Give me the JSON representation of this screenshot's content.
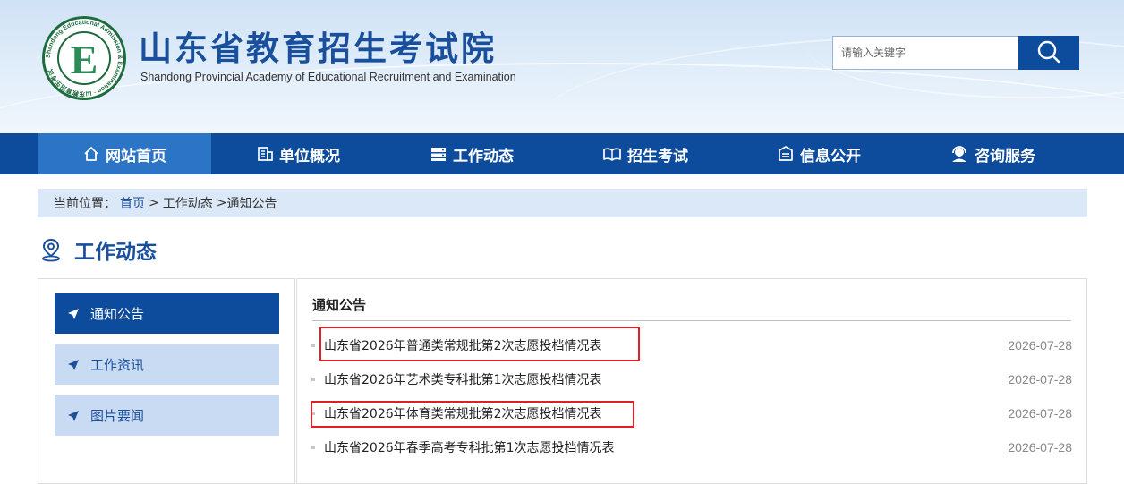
{
  "header": {
    "seal_text": "Shandong Educational Admission & Examination · 山东教育招生考试",
    "seal_letter": "E",
    "title": "山东省教育招生考试院",
    "subtitle": "Shandong Provincial Academy of Educational Recruitment and Examination",
    "search_placeholder": "请输入关键字",
    "search_icon": "search-icon"
  },
  "nav": {
    "items": [
      {
        "label": "网站首页",
        "icon": "home-icon",
        "active": true
      },
      {
        "label": "单位概况",
        "icon": "building-icon",
        "active": false
      },
      {
        "label": "工作动态",
        "icon": "server-icon",
        "active": false
      },
      {
        "label": "招生考试",
        "icon": "book-icon",
        "active": false
      },
      {
        "label": "信息公开",
        "icon": "inbox-icon",
        "active": false
      },
      {
        "label": "咨询服务",
        "icon": "support-icon",
        "active": false
      }
    ]
  },
  "breadcrumb": {
    "prefix": "当前位置：",
    "home": "首页",
    "sep1": ">",
    "level1": "工作动态",
    "sep2": ">",
    "level2": "通知公告"
  },
  "section": {
    "title": "工作动态",
    "icon": "location-pin-icon"
  },
  "sidebar": {
    "items": [
      {
        "label": "通知公告",
        "active": true
      },
      {
        "label": "工作资讯",
        "active": false
      },
      {
        "label": "图片要闻",
        "active": false
      }
    ]
  },
  "main": {
    "heading": "通知公告",
    "rows": [
      {
        "title": "山东省2026年普通类常规批第2次志愿投档情况表",
        "date": "2026-07-28",
        "highlighted": true
      },
      {
        "title": "山东省2026年艺术类专科批第1次志愿投档情况表",
        "date": "2026-07-28",
        "highlighted": false
      },
      {
        "title": "山东省2026年体育类常规批第2次志愿投档情况表",
        "date": "2026-07-28",
        "highlighted": true
      },
      {
        "title": "山东省2026年春季高考专科批第1次志愿投档情况表",
        "date": "2026-07-28",
        "highlighted": false
      }
    ]
  },
  "colors": {
    "brand_blue": "#0d4b9c",
    "nav_active": "#2b74c6",
    "highlight_red": "#e01e25",
    "seal_green": "#1e6b3e"
  }
}
